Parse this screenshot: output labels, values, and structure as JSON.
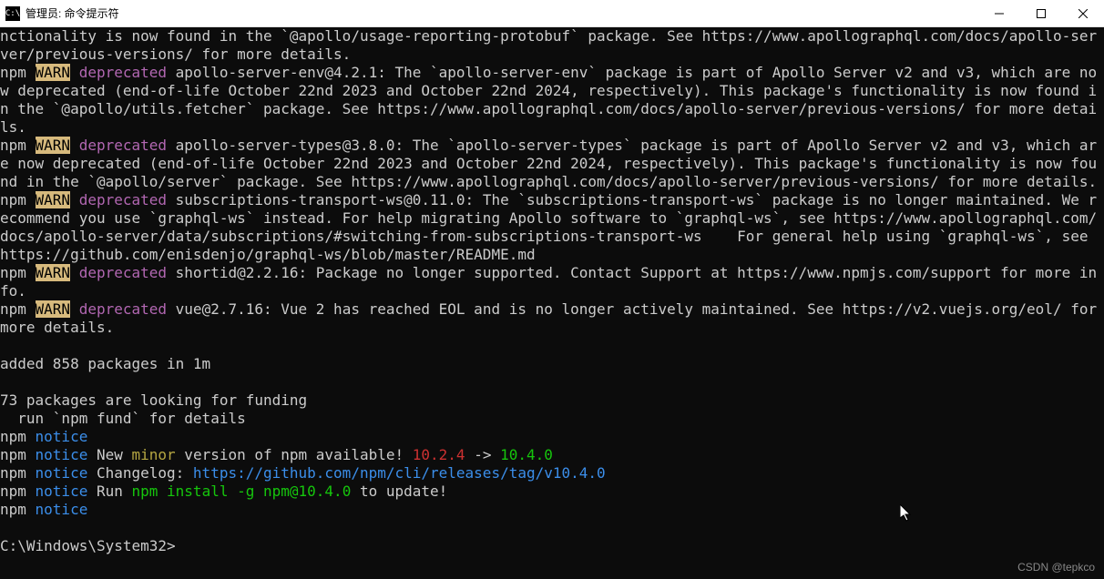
{
  "titlebar": {
    "icon_text": "C:\\",
    "title": "管理员: 命令提示符"
  },
  "lines": {
    "l0": "nctionality is now found in the `@apollo/usage-reporting-protobuf` package. See https://www.apollographql.com/docs/apollo-server/previous-versions/ for more details.",
    "warn1_pre": "npm ",
    "warn1_warn": "WARN",
    "warn1_dep": " deprecated",
    "warn1_rest": " apollo-server-env@4.2.1: The `apollo-server-env` package is part of Apollo Server v2 and v3, which are now deprecated (end-of-life October 22nd 2023 and October 22nd 2024, respectively). This package's functionality is now found in the `@apollo/utils.fetcher` package. See https://www.apollographql.com/docs/apollo-server/previous-versions/ for more details.",
    "warn2_rest": " apollo-server-types@3.8.0: The `apollo-server-types` package is part of Apollo Server v2 and v3, which are now deprecated (end-of-life October 22nd 2023 and October 22nd 2024, respectively). This package's functionality is now found in the `@apollo/server` package. See https://www.apollographql.com/docs/apollo-server/previous-versions/ for more details.",
    "warn3_rest": " subscriptions-transport-ws@0.11.0: The `subscriptions-transport-ws` package is no longer maintained. We recommend you use `graphql-ws` instead. For help migrating Apollo software to `graphql-ws`, see https://www.apollographql.com/docs/apollo-server/data/subscriptions/#switching-from-subscriptions-transport-ws    For general help using `graphql-ws`, see https://github.com/enisdenjo/graphql-ws/blob/master/README.md",
    "warn4_rest": " shortid@2.2.16: Package no longer supported. Contact Support at https://www.npmjs.com/support for more info.",
    "warn5_rest": " vue@2.7.16: Vue 2 has reached EOL and is no longer actively maintained. See https://v2.vuejs.org/eol/ for more details.",
    "blank": "",
    "added": "added 858 packages in 1m",
    "funding1": "73 packages are looking for funding",
    "funding2": "  run `npm fund` for details",
    "notice_pre": "npm ",
    "notice_tag": "notice",
    "notice2_new": " New ",
    "notice2_minor": "minor",
    "notice2_mid": " version of npm available! ",
    "notice2_oldv": "10.2.4",
    "notice2_arrow": " -> ",
    "notice2_newv": "10.4.0",
    "notice3_cl": " Changelog: ",
    "notice3_url": "https://github.com/npm/cli/releases/tag/v10.4.0",
    "notice4_run": " Run ",
    "notice4_cmd": "npm install -g npm@10.4.0",
    "notice4_end": " to update!",
    "prompt": "C:\\Windows\\System32>"
  },
  "watermark": "CSDN @tepkco"
}
